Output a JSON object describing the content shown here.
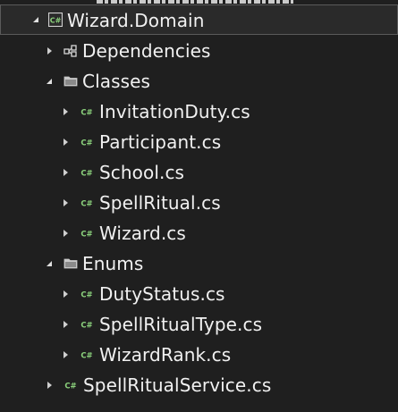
{
  "tree": {
    "project": {
      "label": "Wizard.Domain",
      "icon": "csharp-project-icon",
      "expanded": true
    },
    "dependencies": {
      "label": "Dependencies",
      "icon": "dependencies-icon",
      "expanded": false
    },
    "classes_folder": {
      "label": "Classes",
      "icon": "folder-icon",
      "expanded": true
    },
    "classes": [
      {
        "label": "InvitationDuty.cs",
        "icon": "csharp-file-icon"
      },
      {
        "label": "Participant.cs",
        "icon": "csharp-file-icon"
      },
      {
        "label": "School.cs",
        "icon": "csharp-file-icon"
      },
      {
        "label": "SpellRitual.cs",
        "icon": "csharp-file-icon"
      },
      {
        "label": "Wizard.cs",
        "icon": "csharp-file-icon"
      }
    ],
    "enums_folder": {
      "label": "Enums",
      "icon": "folder-icon",
      "expanded": true
    },
    "enums": [
      {
        "label": "DutyStatus.cs",
        "icon": "csharp-file-icon"
      },
      {
        "label": "SpellRitualType.cs",
        "icon": "csharp-file-icon"
      },
      {
        "label": "WizardRank.cs",
        "icon": "csharp-file-icon"
      }
    ],
    "service_file": {
      "label": "SpellRitualService.cs",
      "icon": "csharp-file-icon"
    }
  },
  "colors": {
    "background": "#1f1f1f",
    "selected_background": "#2a2a2a",
    "selected_border": "#5a5a5a",
    "csharp_green": "#8bd17c",
    "folder": "#c8c8c8",
    "text": "#f1f1f1"
  }
}
